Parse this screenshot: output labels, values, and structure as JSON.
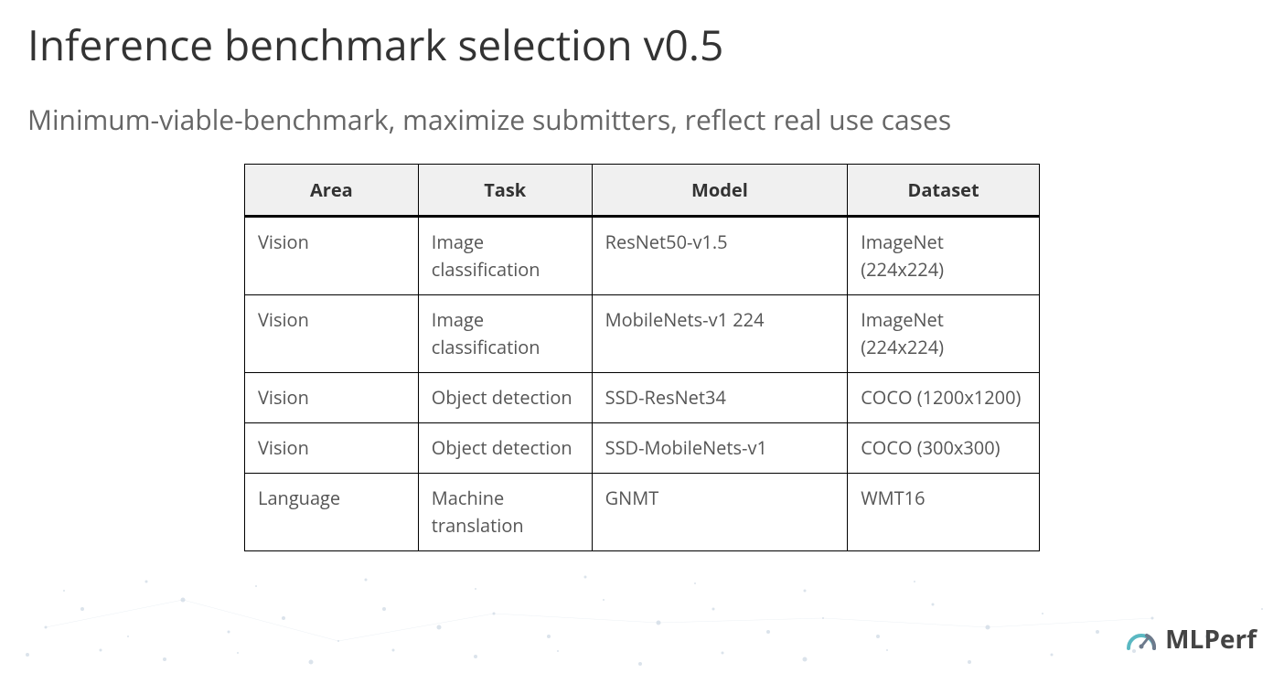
{
  "title": "Inference benchmark selection v0.5",
  "subtitle": "Minimum-viable-benchmark, maximize submitters, reflect real use cases",
  "chart_data": {
    "type": "table",
    "headers": [
      "Area",
      "Task",
      "Model",
      "Dataset"
    ],
    "rows": [
      {
        "area": "Vision",
        "task": "Image classification",
        "model": "ResNet50-v1.5",
        "dataset": "ImageNet (224x224)"
      },
      {
        "area": "Vision",
        "task": "Image classification",
        "model": "MobileNets-v1 224",
        "dataset": "ImageNet (224x224)"
      },
      {
        "area": "Vision",
        "task": "Object detection",
        "model": "SSD-ResNet34",
        "dataset": "COCO (1200x1200)"
      },
      {
        "area": "Vision",
        "task": "Object detection",
        "model": "SSD-MobileNets-v1",
        "dataset": "COCO (300x300)"
      },
      {
        "area": "Language",
        "task": "Machine translation",
        "model": "GNMT",
        "dataset": "WMT16"
      }
    ]
  },
  "logo": {
    "text": "MLPerf"
  }
}
